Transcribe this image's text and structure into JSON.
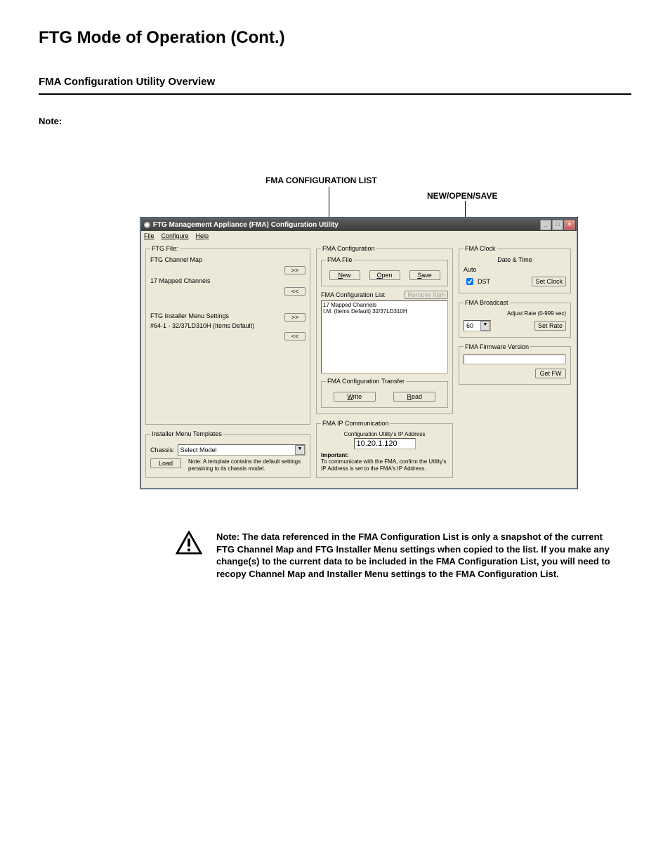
{
  "page": {
    "title": "FTG Mode of Operation (Cont.)",
    "section": "FMA Configuration Utility Overview",
    "note_label": "Note:"
  },
  "callouts": {
    "config_list": "FMA CONFIGURATION LIST",
    "new_open_save": "NEW/OPEN/SAVE"
  },
  "window": {
    "title": "FTG Management Appliance (FMA) Configuration Utility",
    "menu": {
      "file": "File",
      "configure": "Configure",
      "help": "Help"
    }
  },
  "ftg_file": {
    "legend": "FTG File:",
    "channel_map_label": "FTG Channel Map",
    "btn_add": ">>",
    "mapped_text": "17 Mapped Channels",
    "btn_remove": "<<",
    "installer_label": "FTG Installer Menu Settings",
    "btn_add2": ">>",
    "installer_text": "#64-1 - 32/37LD310H (Items Default)",
    "btn_remove2": "<<"
  },
  "templates": {
    "legend": "Installer Menu Templates",
    "chassis_label": "Chassis:",
    "chassis_value": "Select Model",
    "load": "Load",
    "note": "Note:  A template contains the default settings pertaining to its chassis model."
  },
  "fma_config": {
    "legend": "FMA Configuration",
    "file_legend": "FMA File",
    "new": "New",
    "open": "Open",
    "save": "Save",
    "list_legend": "FMA Configuration List",
    "remove": "Remove Item",
    "list_items": [
      "17 Mapped Channels",
      "I.M. (Items Default) 32/37LD310H"
    ],
    "transfer_legend": "FMA Configuration Transfer",
    "write": "Write",
    "read": "Read"
  },
  "clock": {
    "legend": "FMA Clock",
    "date_time": "Date & Time",
    "auto": "Auto",
    "dst": "DST",
    "set_clock": "Set Clock"
  },
  "broadcast": {
    "legend": "FMA Broadcast",
    "rate_label": "Adjust Rate (0-999 sec)",
    "rate_value": "60",
    "set_rate": "Set Rate"
  },
  "fw": {
    "legend": "FMA Firmware Version",
    "value": "",
    "get_fw": "Get FW"
  },
  "ip": {
    "legend": "FMA IP Communication",
    "sublabel": "Configuration Utility's IP Address",
    "value": "10.20.1.120",
    "important_label": "Important:",
    "important_text": "To communicate with the FMA, confirm the Utility's IP Address is set to the FMA's IP Address."
  },
  "bottom_note": "Note: The data referenced in the FMA Configuration List is only a snapshot of the current FTG Channel Map and FTG Installer Menu settings when copied to the list. If you make any change(s) to the current data to be included in the FMA Configuration List, you will need to recopy Channel Map and Installer Menu settings to the FMA Configuration List."
}
